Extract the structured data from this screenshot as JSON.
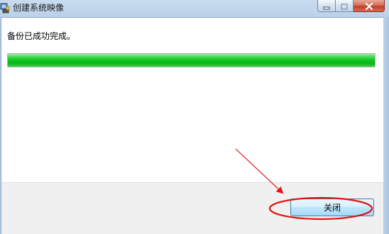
{
  "window": {
    "title": "创建系统映像"
  },
  "main": {
    "message": "备份已成功完成。",
    "progress_fraction": 1.0
  },
  "footer": {
    "close_label": "关闭"
  },
  "icons": {
    "window_icon": "backup-icon",
    "minimize": "minimize-icon",
    "maximize": "maximize-icon",
    "close": "close-icon"
  },
  "colors": {
    "progress_fill": "#0fc420",
    "annotation": "#e01414",
    "close_caption": "#c2402a",
    "button_border": "#3c7fb1"
  }
}
